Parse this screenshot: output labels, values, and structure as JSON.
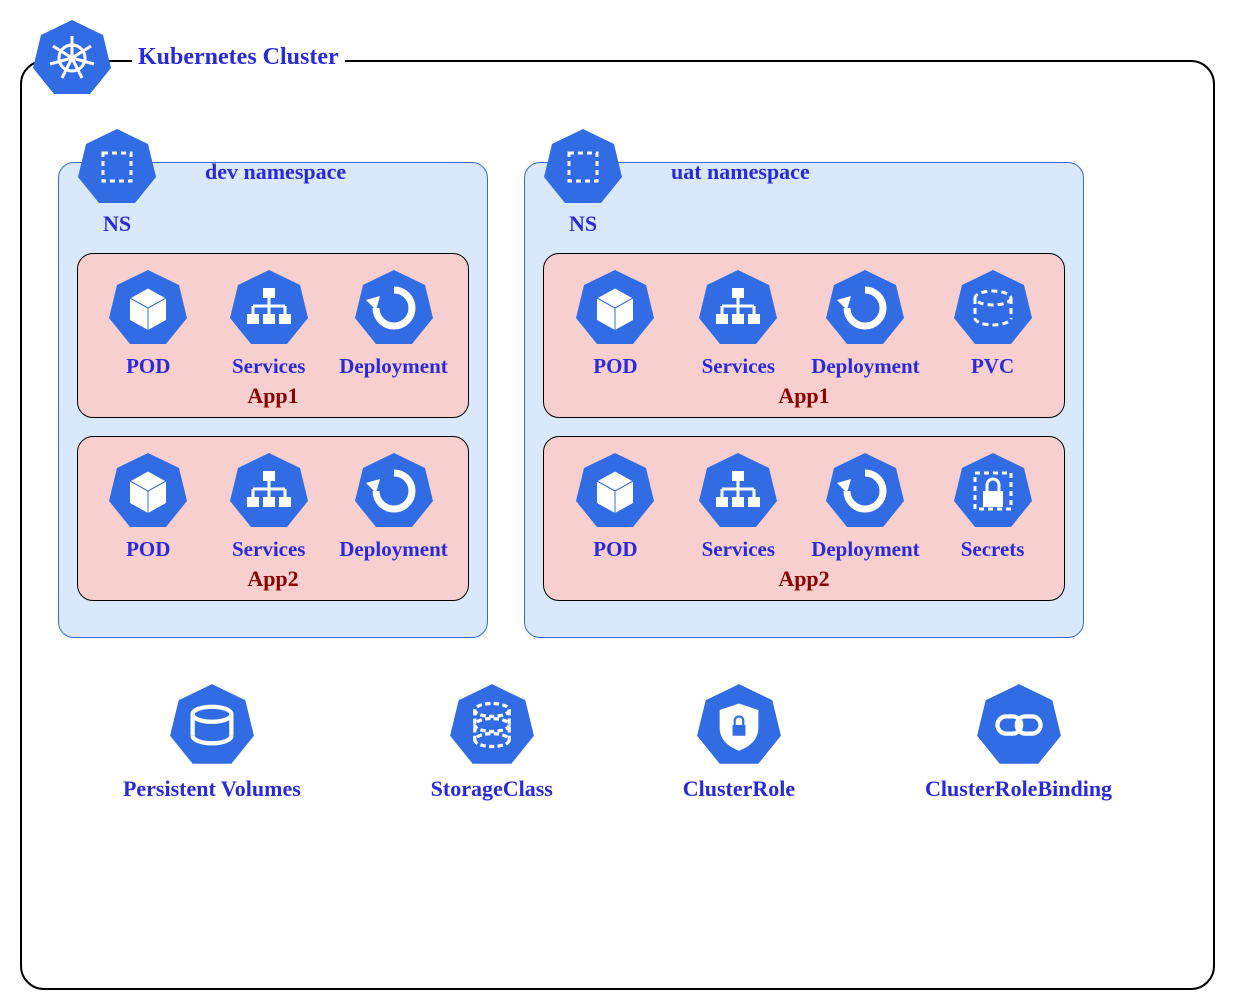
{
  "cluster": {
    "title": "Kubernetes Cluster"
  },
  "namespaces": {
    "dev": {
      "title": "dev namespace",
      "nsLabel": "NS",
      "app1": {
        "label": "App1",
        "pod": "POD",
        "services": "Services",
        "deployment": "Deployment"
      },
      "app2": {
        "label": "App2",
        "pod": "POD",
        "services": "Services",
        "deployment": "Deployment"
      }
    },
    "uat": {
      "title": "uat namespace",
      "nsLabel": "NS",
      "app1": {
        "label": "App1",
        "pod": "POD",
        "services": "Services",
        "deployment": "Deployment",
        "pvc": "PVC"
      },
      "app2": {
        "label": "App2",
        "pod": "POD",
        "services": "Services",
        "deployment": "Deployment",
        "secrets": "Secrets"
      }
    }
  },
  "clusterResources": {
    "pv": "Persistent Volumes",
    "sc": "StorageClass",
    "cr": "ClusterRole",
    "crb": "ClusterRoleBinding"
  }
}
